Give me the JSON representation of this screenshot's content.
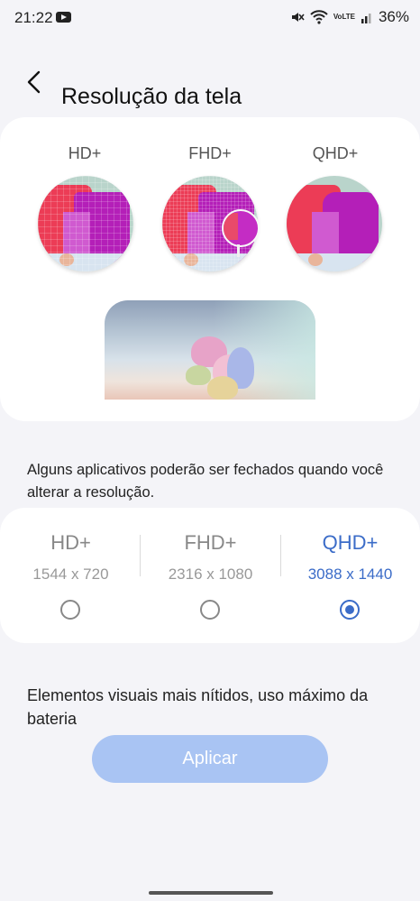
{
  "status_bar": {
    "time": "21:22",
    "battery": "36%",
    "volte": "VoLTE"
  },
  "header": {
    "title": "Resolução da tela"
  },
  "preview": {
    "labels": [
      "HD+",
      "FHD+",
      "QHD+"
    ]
  },
  "note_close_apps": "Alguns aplicativos poderão ser fechados quando você alterar a resolução.",
  "options": [
    {
      "name": "HD+",
      "dims": "1544 x 720",
      "selected": false
    },
    {
      "name": "FHD+",
      "dims": "2316 x 1080",
      "selected": false
    },
    {
      "name": "QHD+",
      "dims": "3088 x 1440",
      "selected": true
    }
  ],
  "note_selected": "Elementos visuais mais nítidos, uso máximo da bateria",
  "apply_label": "Aplicar",
  "colors": {
    "accent": "#3b6cc8",
    "button_bg": "#a9c4f3",
    "card_bg": "#ffffff",
    "page_bg": "#f4f4f8"
  },
  "icons": [
    "youtube-icon",
    "mute-icon",
    "wifi-icon",
    "signal-icon",
    "back-arrow-icon",
    "radio-button-icon"
  ]
}
